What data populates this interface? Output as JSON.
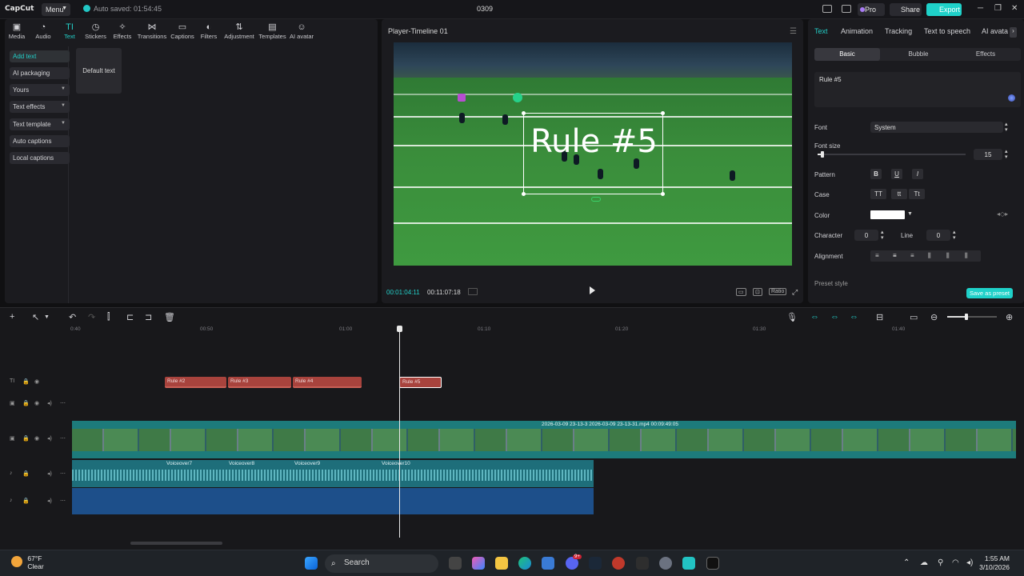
{
  "titlebar": {
    "logo": "CapCut",
    "menu_label": "Menu",
    "autosave_text": "Auto saved: 01:54:45",
    "project_name": "0309",
    "pro_label": "Pro",
    "share_label": "Share",
    "export_label": "Export"
  },
  "toolbar_tabs": [
    {
      "label": "Media",
      "icon": "media-icon"
    },
    {
      "label": "Audio",
      "icon": "audio-icon"
    },
    {
      "label": "Text",
      "icon": "text-icon",
      "active": true
    },
    {
      "label": "Stickers",
      "icon": "sticker-icon"
    },
    {
      "label": "Effects",
      "icon": "effects-icon"
    },
    {
      "label": "Transitions",
      "icon": "transitions-icon"
    },
    {
      "label": "Captions",
      "icon": "captions-icon"
    },
    {
      "label": "Filters",
      "icon": "filters-icon"
    },
    {
      "label": "Adjustment",
      "icon": "adjustment-icon"
    },
    {
      "label": "Templates",
      "icon": "templates-icon"
    },
    {
      "label": "AI avatar",
      "icon": "ai-avatar-icon"
    }
  ],
  "text_sidebar": [
    {
      "label": "Add text",
      "active": true
    },
    {
      "label": "AI packaging"
    },
    {
      "label": "Yours",
      "has_chevron": true
    },
    {
      "label": "Text effects",
      "has_chevron": true
    },
    {
      "label": "Text template",
      "has_chevron": true
    },
    {
      "label": "Auto captions"
    },
    {
      "label": "Local captions"
    }
  ],
  "default_text_card": "Default text",
  "player": {
    "title": "Player-Timeline 01",
    "overlay_text": "Rule #5",
    "current_time": "00:01:04:11",
    "duration": "00:11:07:18",
    "ratio_label": "Ratio"
  },
  "right_panel": {
    "tabs": [
      "Text",
      "Animation",
      "Tracking",
      "Text to speech",
      "AI avatar"
    ],
    "active_tab": "Text",
    "subtabs": [
      "Basic",
      "Bubble",
      "Effects"
    ],
    "text_value": "Rule #5",
    "font_label": "Font",
    "font_value": "System",
    "font_size_label": "Font size",
    "font_size_value": "15",
    "font_size_fraction": 0.02,
    "pattern_label": "Pattern",
    "pattern_buttons": [
      "B",
      "U",
      "I"
    ],
    "case_label": "Case",
    "case_buttons": [
      "TT",
      "tt",
      "Tt"
    ],
    "color_label": "Color",
    "color_value": "#ffffff",
    "character_label": "Character",
    "character_value": "0",
    "line_label": "Line",
    "line_value": "0",
    "alignment_label": "Alignment",
    "preset_style_label": "Preset style",
    "save_preset_label": "Save as preset"
  },
  "timeline": {
    "ruler_ticks": [
      "0:40",
      "00:50",
      "01:00",
      "01:10",
      "01:20",
      "01:30",
      "01:40"
    ],
    "text_clips": [
      "Rule #2",
      "Rule #3",
      "Rule #4",
      "Rule #5"
    ],
    "video_label": "2026-03-09 23-13-3  2026-03-09 23-13-31.mp4  00:09:49:05",
    "voiceovers": [
      "Voiceover7",
      "Voiceover8",
      "Voiceover9",
      "Voiceover10"
    ]
  },
  "taskbar": {
    "weather_temp": "67°F",
    "weather_desc": "Clear",
    "search_label": "Search",
    "time": "1:55 AM",
    "date": "3/10/2026",
    "notification_badge": "9+"
  }
}
